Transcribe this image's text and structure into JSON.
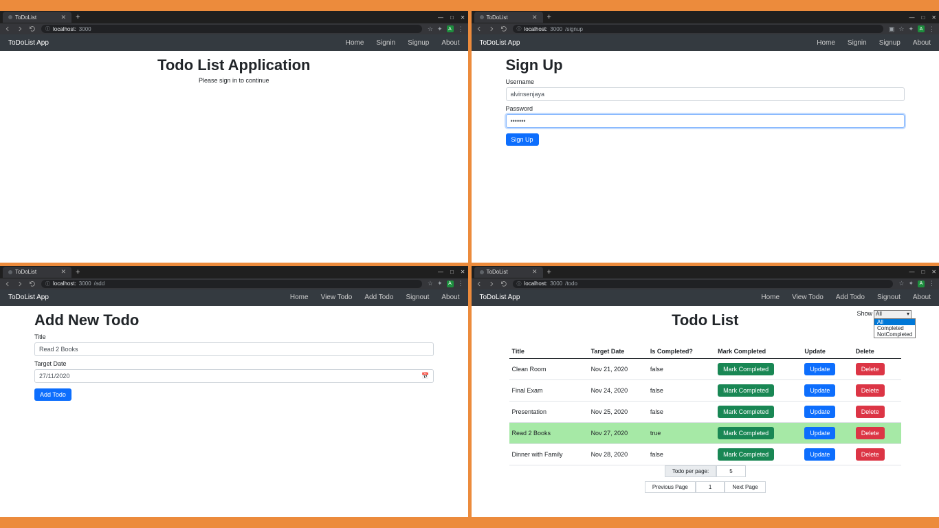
{
  "tab_title": "ToDoList",
  "brand": "ToDoList App",
  "window_controls": {
    "min": "—",
    "max": "□",
    "close": "✕"
  },
  "panes": {
    "home": {
      "url_host": "localhost:",
      "url_port": "3000",
      "url_path": "",
      "nav": [
        "Home",
        "Signin",
        "Signup",
        "About"
      ],
      "title": "Todo List Application",
      "subtitle": "Please sign in to continue"
    },
    "signup": {
      "url_host": "localhost:",
      "url_port": "3000",
      "url_path": "/signup",
      "nav": [
        "Home",
        "Signin",
        "Signup",
        "About"
      ],
      "title": "Sign Up",
      "username_label": "Username",
      "username_value": "alvinsenjaya",
      "password_label": "Password",
      "password_value": "•••••••",
      "button": "Sign Up"
    },
    "add": {
      "url_host": "localhost:",
      "url_port": "3000",
      "url_path": "/add",
      "nav": [
        "Home",
        "View Todo",
        "Add Todo",
        "Signout",
        "About"
      ],
      "title": "Add New Todo",
      "title_label": "Title",
      "title_value": "Read 2 Books",
      "date_label": "Target Date",
      "date_value": "27/11/2020",
      "button": "Add Todo"
    },
    "list": {
      "url_host": "localhost:",
      "url_port": "3000",
      "url_path": "/todo",
      "nav": [
        "Home",
        "View Todo",
        "Add Todo",
        "Signout",
        "About"
      ],
      "title": "Todo List",
      "show_label": "Show",
      "show_value": "All",
      "show_options": [
        "All",
        "Completed",
        "NotCompleted"
      ],
      "headers": [
        "Title",
        "Target Date",
        "Is Completed?",
        "Mark Completed",
        "Update",
        "Delete"
      ],
      "rows": [
        {
          "title": "Clean Room",
          "date": "Nov 21, 2020",
          "done": "false",
          "completed": false
        },
        {
          "title": "Final Exam",
          "date": "Nov 24, 2020",
          "done": "false",
          "completed": false
        },
        {
          "title": "Presentation",
          "date": "Nov 25, 2020",
          "done": "false",
          "completed": false
        },
        {
          "title": "Read 2 Books",
          "date": "Nov 27, 2020",
          "done": "true",
          "completed": true
        },
        {
          "title": "Dinner with Family",
          "date": "Nov 28, 2020",
          "done": "false",
          "completed": false
        }
      ],
      "mark_btn": "Mark Completed",
      "update_btn": "Update",
      "delete_btn": "Delete",
      "per_page_label": "Todo per page:",
      "per_page_value": "5",
      "prev": "Previous Page",
      "page": "1",
      "next": "Next Page"
    }
  }
}
